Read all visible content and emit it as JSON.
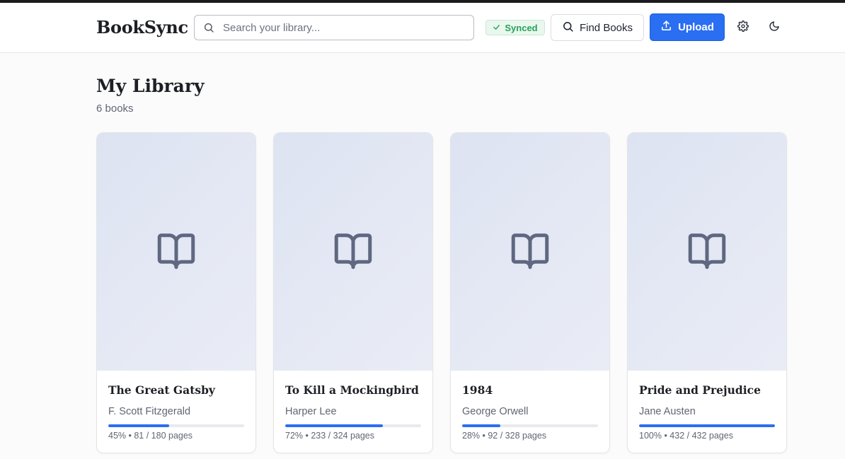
{
  "app": {
    "name": "BookSync"
  },
  "header": {
    "search_placeholder": "Search your library...",
    "sync_status": "Synced",
    "find_books_label": "Find Books",
    "upload_label": "Upload",
    "icons": {
      "search": "search-icon",
      "check": "check-icon",
      "settings": "gear-icon",
      "theme": "moon-icon",
      "upload": "upload-icon"
    }
  },
  "library": {
    "title": "My Library",
    "count": "6 books",
    "books": [
      {
        "title": "The Great Gatsby",
        "author": "F. Scott Fitzgerald",
        "progress": 0.45,
        "meta": "45% • 81 / 180 pages"
      },
      {
        "title": "To Kill a Mockingbird",
        "author": "Harper Lee",
        "progress": 0.72,
        "meta": "72% • 233 / 324 pages"
      },
      {
        "title": "1984",
        "author": "George Orwell",
        "progress": 0.28,
        "meta": "28% • 92 / 328 pages"
      },
      {
        "title": "Pride and Prejudice",
        "author": "Jane Austen",
        "progress": 1.0,
        "meta": "100% • 432 / 432 pages"
      }
    ]
  },
  "colors": {
    "accent": "#2a6ef2",
    "synced": "#27a35a",
    "cover_bg": "#dde3f2",
    "cover_icon": "#5f6880"
  }
}
